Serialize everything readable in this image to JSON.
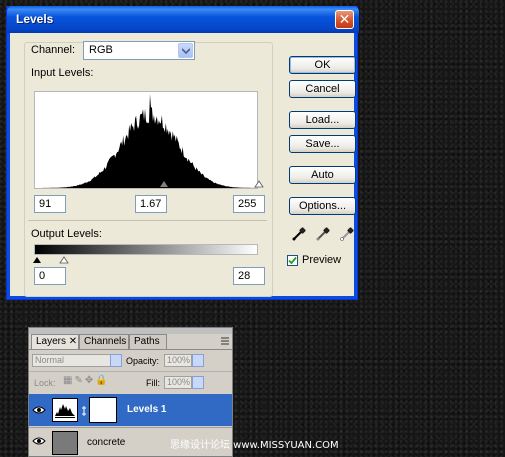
{
  "dialog": {
    "title": "Levels",
    "close_icon": "close-icon",
    "channel_label": "Channel:",
    "channel_value": "RGB",
    "input_levels_label": "Input Levels:",
    "input_black": "91",
    "input_gamma": "1.67",
    "input_white": "255",
    "output_levels_label": "Output Levels:",
    "output_black": "0",
    "output_white": "28",
    "buttons": {
      "ok": "OK",
      "cancel": "Cancel",
      "load": "Load...",
      "save": "Save...",
      "auto": "Auto",
      "options": "Options..."
    },
    "droppers": [
      "black-eyedropper-icon",
      "gray-eyedropper-icon",
      "white-eyedropper-icon"
    ],
    "preview_label": "Preview",
    "preview_checked": true
  },
  "layers_panel": {
    "tabs": [
      "Layers",
      "Channels",
      "Paths"
    ],
    "blend_mode": "Normal",
    "opacity_label": "Opacity:",
    "opacity_value": "100%",
    "lock_label": "Lock:",
    "fill_label": "Fill:",
    "fill_value": "100%",
    "layers": [
      {
        "name": "Levels 1",
        "selected": true
      },
      {
        "name": "concrete",
        "selected": false
      }
    ]
  },
  "watermark": "思缘设计论坛 www.MISSYUAN.COM",
  "colors": {
    "title_bar": "#0a5fe8",
    "selected_layer": "#316ac5",
    "dialog_bg": "#ece9d8"
  }
}
